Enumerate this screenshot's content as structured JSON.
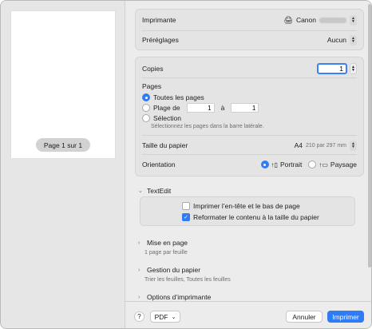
{
  "preview": {
    "page_indicator": "Page 1 sur 1"
  },
  "printer": {
    "label": "Imprimante",
    "value": "Canon",
    "icon": "printer-icon"
  },
  "presets": {
    "label": "Préréglages",
    "value": "Aucun"
  },
  "copies": {
    "label": "Copies",
    "value": "1"
  },
  "pages": {
    "label": "Pages",
    "all_label": "Toutes les pages",
    "range_label": "Plage de",
    "range_from": "1",
    "range_to_label": "à",
    "range_to": "1",
    "selection_label": "Sélection",
    "selection_hint": "Sélectionnez les pages dans la barre latérale.",
    "selected": "all"
  },
  "paper_size": {
    "label": "Taille du papier",
    "value": "A4",
    "detail": "210 par 297 mm"
  },
  "orientation": {
    "label": "Orientation",
    "portrait_label": "Portrait",
    "landscape_label": "Paysage",
    "selected": "portrait"
  },
  "textedit": {
    "label": "TextEdit",
    "header_footer_label": "Imprimer l’en-tête et le bas de page",
    "header_footer_checked": false,
    "rewrap_label": "Reformater le contenu à la taille du papier",
    "rewrap_checked": true
  },
  "layout": {
    "label": "Mise en page",
    "summary": "1 page par feuille"
  },
  "paper_handling": {
    "label": "Gestion du papier",
    "summary": "Trier les feuilles, Toutes les feuilles"
  },
  "printer_options": {
    "label": "Options d’imprimante"
  },
  "footer": {
    "help_label": "?",
    "pdf_label": "PDF",
    "cancel_label": "Annuler",
    "print_label": "Imprimer"
  },
  "colors": {
    "accent": "#2f7cf6"
  }
}
